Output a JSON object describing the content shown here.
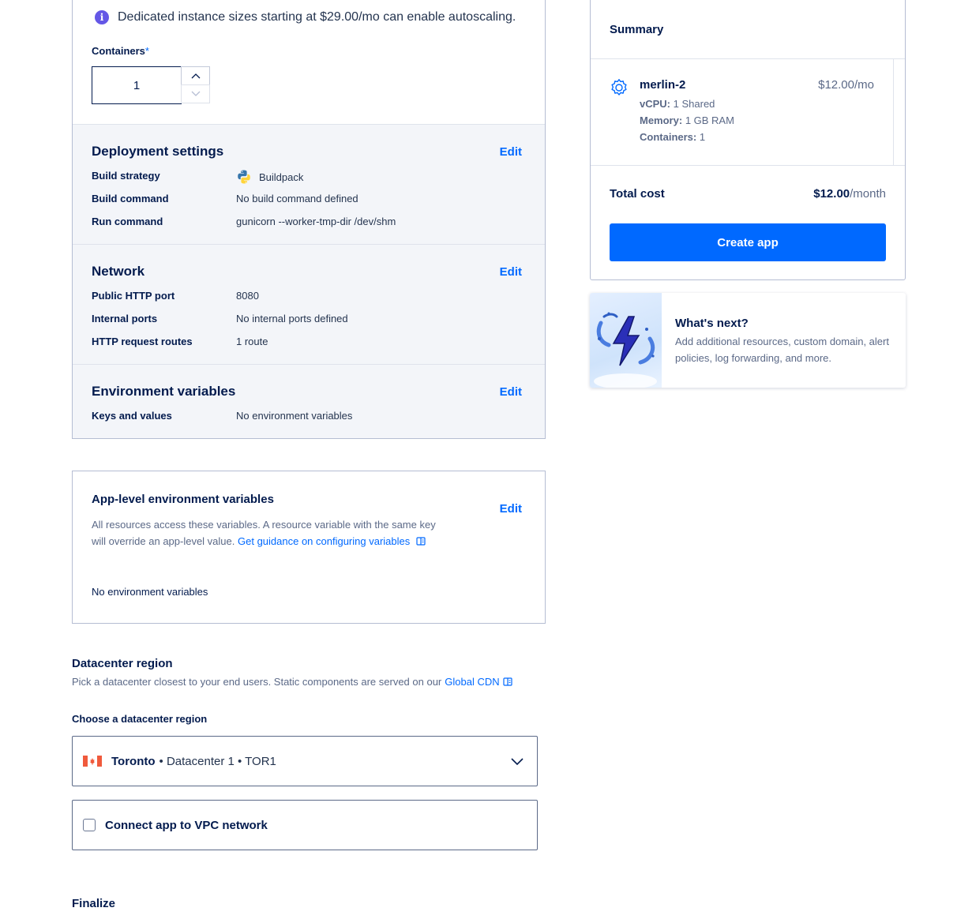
{
  "component": {
    "info_text": "Dedicated instance sizes starting at $29.00/mo can enable autoscaling.",
    "containers_label": "Containers",
    "required_mark": "*",
    "containers_value": "1"
  },
  "deployment": {
    "title": "Deployment settings",
    "edit_label": "Edit",
    "rows": [
      {
        "key": "Build strategy",
        "value": "Buildpack"
      },
      {
        "key": "Build command",
        "value": "No build command defined"
      },
      {
        "key": "Run command",
        "value": "gunicorn --worker-tmp-dir /dev/shm"
      }
    ]
  },
  "network": {
    "title": "Network",
    "edit_label": "Edit",
    "rows": [
      {
        "key": "Public HTTP port",
        "value": "8080"
      },
      {
        "key": "Internal ports",
        "value": "No internal ports defined"
      },
      {
        "key": "HTTP request routes",
        "value": "1 route"
      }
    ]
  },
  "env": {
    "title": "Environment variables",
    "edit_label": "Edit",
    "rows": [
      {
        "key": "Keys and values",
        "value": "No environment variables"
      }
    ]
  },
  "app_env": {
    "title": "App-level environment variables",
    "edit_label": "Edit",
    "desc": "All resources access these variables. A resource variable with the same key will override an app-level value.",
    "link": "Get guidance on configuring variables",
    "empty": "No environment variables"
  },
  "datacenter": {
    "title": "Datacenter region",
    "subtitle": "Pick a datacenter closest to your end users. Static components are served on our",
    "cdn_link": "Global CDN",
    "choose_label": "Choose a datacenter region",
    "selected_city": "Toronto",
    "selected_detail": "• Datacenter 1 • TOR1",
    "vpc_label": "Connect app to VPC network"
  },
  "finalize_title": "Finalize",
  "summary": {
    "title": "Summary",
    "resource_name": "merlin-2",
    "resource_price": "$12.00/mo",
    "vcpu_label": "vCPU:",
    "vcpu_value": "1 Shared",
    "memory_label": "Memory:",
    "memory_value": "1 GB RAM",
    "containers_label": "Containers:",
    "containers_value": "1",
    "total_label": "Total cost",
    "total_amount": "$12.00",
    "total_period": "/month",
    "create_button": "Create app"
  },
  "whats_next": {
    "title": "What's next?",
    "desc": "Add additional resources, custom domain, alert policies, log forwarding, and more."
  },
  "colors": {
    "accent": "#0069ff",
    "text_dark": "#031b4e",
    "text_muted": "#5b6987",
    "section_bg": "#f3f5f9",
    "info_purple": "#6457e6"
  }
}
